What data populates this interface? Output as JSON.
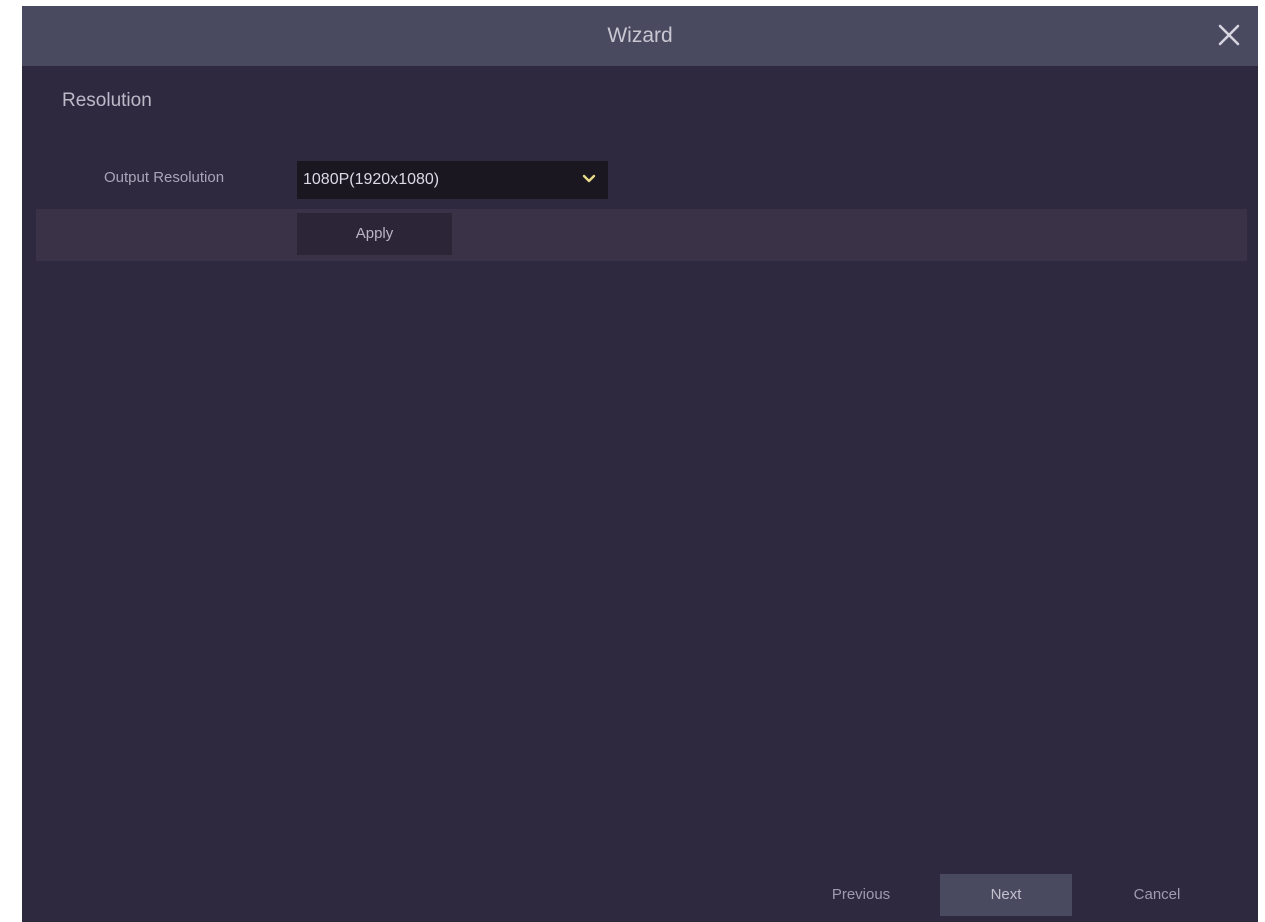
{
  "window": {
    "title": "Wizard"
  },
  "section": {
    "title": "Resolution"
  },
  "output_resolution": {
    "label": "Output Resolution",
    "value": "1080P(1920x1080)",
    "apply_label": "Apply"
  },
  "footer": {
    "previous_label": "Previous",
    "next_label": "Next",
    "cancel_label": "Cancel"
  },
  "icons": {
    "close": "close-icon",
    "dropdown": "chevron-down-icon"
  },
  "colors": {
    "background": "#2f2940",
    "titlebar": "#49495f",
    "dropdown_accent": "#e8d98a"
  }
}
